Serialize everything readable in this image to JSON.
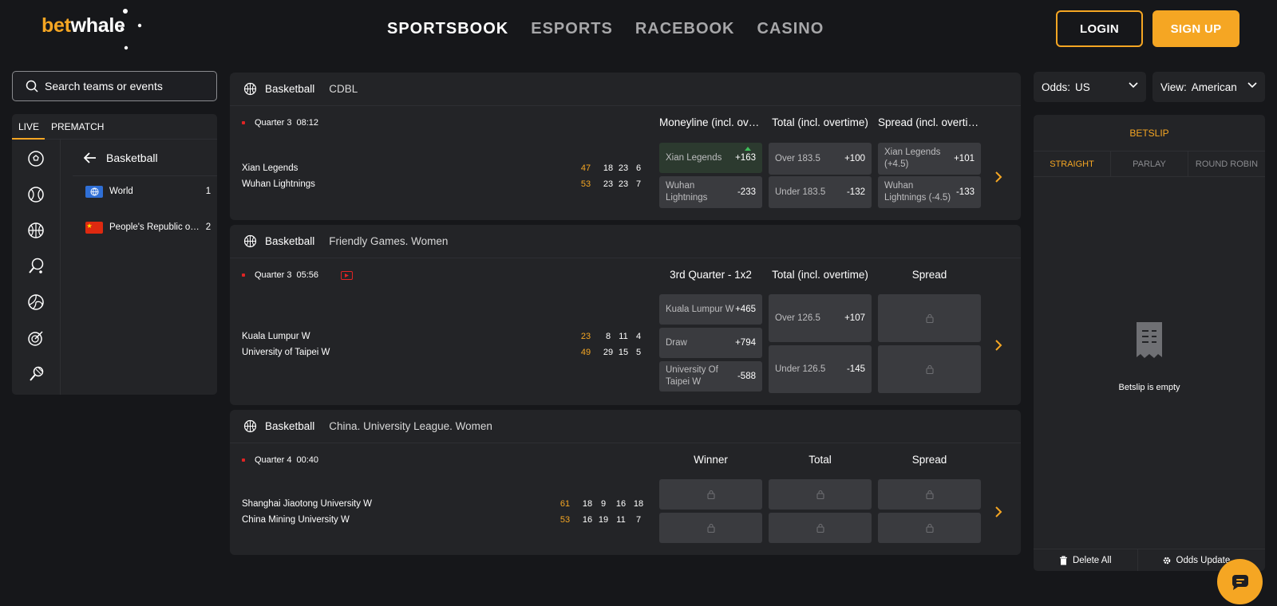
{
  "header": {
    "logo": {
      "part1": "bet",
      "part2": "whale"
    },
    "nav": [
      "SPORTSBOOK",
      "ESPORTS",
      "RACEBOOK",
      "CASINO"
    ],
    "login": "LOGIN",
    "signup": "SIGN UP"
  },
  "search": {
    "placeholder": "Search teams or events"
  },
  "left": {
    "tabs": [
      "LIVE",
      "PREMATCH"
    ],
    "sport_icons": [
      "soccer-icon",
      "tennis-icon",
      "basketball-icon",
      "table-tennis-icon",
      "volleyball-icon",
      "darts-icon",
      "badminton-icon"
    ],
    "back_label": "Basketball",
    "regions": [
      {
        "name": "World",
        "count": "1"
      },
      {
        "name": "People's Republic of China",
        "count": "2"
      }
    ]
  },
  "events": [
    {
      "sport": "Basketball",
      "league": "CDBL",
      "period": "Quarter 3",
      "time": "08:12",
      "teams": [
        "Xian Legends",
        "Wuhan Lightnings"
      ],
      "totals": [
        "47",
        "53"
      ],
      "quarters": [
        [
          "18",
          "23",
          "6"
        ],
        [
          "23",
          "23",
          "7"
        ]
      ],
      "markets": [
        "Moneyline (incl. overtime)",
        "Total (incl. overtime)",
        "Spread (incl. overtime)"
      ],
      "odds": {
        "m1": [
          {
            "label": "Xian Legends",
            "value": "+163"
          },
          {
            "label": "Wuhan Lightnings",
            "value": "-233"
          }
        ],
        "m2": [
          {
            "label": "Over 183.5",
            "value": "+100"
          },
          {
            "label": "Under 183.5",
            "value": "-132"
          }
        ],
        "m3": [
          {
            "label": "Xian Legends (+4.5)",
            "value": "+101"
          },
          {
            "label": "Wuhan Lightnings (-4.5)",
            "value": "-133"
          }
        ]
      }
    },
    {
      "sport": "Basketball",
      "league": "Friendly Games. Women",
      "period": "Quarter 3",
      "time": "05:56",
      "teams": [
        "Kuala Lumpur W",
        "University of Taipei W"
      ],
      "totals": [
        "23",
        "49"
      ],
      "quarters": [
        [
          "8",
          "11",
          "4"
        ],
        [
          "29",
          "15",
          "5"
        ]
      ],
      "markets": [
        "3rd Quarter - 1x2",
        "Total (incl. overtime)",
        "Spread"
      ],
      "odds": {
        "m1": [
          {
            "label": "Kuala Lumpur W",
            "value": "+465"
          },
          {
            "label": "Draw",
            "value": "+794"
          },
          {
            "label": "University Of Taipei W",
            "value": "-588"
          }
        ],
        "m2": [
          {
            "label": "Over 126.5",
            "value": "+107"
          },
          {
            "label": "Under 126.5",
            "value": "-145"
          }
        ]
      }
    },
    {
      "sport": "Basketball",
      "league": "China. University League. Women",
      "period": "Quarter 4",
      "time": "00:40",
      "teams": [
        "Shanghai Jiaotong University W",
        "China Mining University W"
      ],
      "totals": [
        "61",
        "53"
      ],
      "quarters": [
        [
          "18",
          "9",
          "16",
          "18"
        ],
        [
          "16",
          "19",
          "11",
          "7"
        ]
      ],
      "markets": [
        "Winner",
        "Total",
        "Spread"
      ]
    }
  ],
  "right": {
    "odds_select": {
      "label": "Odds:",
      "value": "US"
    },
    "view_select": {
      "label": "View:",
      "value": "American"
    },
    "betslip": {
      "title": "BETSLIP",
      "tabs": [
        "STRAIGHT",
        "PARLAY",
        "ROUND ROBIN"
      ],
      "empty": "Betslip is empty",
      "delete_all": "Delete All",
      "odds_update": "Odds Update"
    }
  },
  "colors": {
    "accent": "#f5a623",
    "live_red": "#e02424",
    "bg": "#16171a",
    "panel": "#232427",
    "odd_bg": "#3a3b3f"
  }
}
